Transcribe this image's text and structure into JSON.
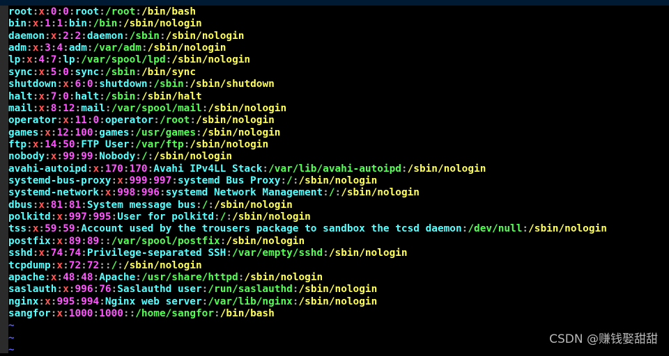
{
  "colors": {
    "name": "#55ffff",
    "password": "#ff5555",
    "ids": "#ff55ff",
    "gecos": "#55ffff",
    "home": "#55ff55",
    "shell": "#ffff55",
    "colon": "#a8a8a8",
    "tilde": "#5c5cff",
    "background": "#000000"
  },
  "lines": [
    "root:x:0:0:root:/root:/bin/bash",
    "bin:x:1:1:bin:/bin:/sbin/nologin",
    "daemon:x:2:2:daemon:/sbin:/sbin/nologin",
    "adm:x:3:4:adm:/var/adm:/sbin/nologin",
    "lp:x:4:7:lp:/var/spool/lpd:/sbin/nologin",
    "sync:x:5:0:sync:/sbin:/bin/sync",
    "shutdown:x:6:0:shutdown:/sbin:/sbin/shutdown",
    "halt:x:7:0:halt:/sbin:/sbin/halt",
    "mail:x:8:12:mail:/var/spool/mail:/sbin/nologin",
    "operator:x:11:0:operator:/root:/sbin/nologin",
    "games:x:12:100:games:/usr/games:/sbin/nologin",
    "ftp:x:14:50:FTP User:/var/ftp:/sbin/nologin",
    "nobody:x:99:99:Nobody:/:/sbin/nologin",
    "avahi-autoipd:x:170:170:Avahi IPv4LL Stack:/var/lib/avahi-autoipd:/sbin/nologin",
    "systemd-bus-proxy:x:999:997:systemd Bus Proxy:/:/sbin/nologin",
    "systemd-network:x:998:996:systemd Network Management:/:/sbin/nologin",
    "dbus:x:81:81:System message bus:/:/sbin/nologin",
    "polkitd:x:997:995:User for polkitd:/:/sbin/nologin",
    "tss:x:59:59:Account used by the trousers package to sandbox the tcsd daemon:/dev/null:/sbin/nologin",
    "postfix:x:89:89::/var/spool/postfix:/sbin/nologin",
    "sshd:x:74:74:Privilege-separated SSH:/var/empty/sshd:/sbin/nologin",
    "tcpdump:x:72:72::/:/sbin/nologin",
    "apache:x:48:48:Apache:/usr/share/httpd:/sbin/nologin",
    "saslauth:x:996:76:Saslauthd user:/run/saslauthd:/sbin/nologin",
    "nginx:x:995:994:Nginx web server:/var/lib/nginx:/sbin/nologin",
    "sangfor:x:1000:1000::/home/sangfor:/bin/bash"
  ],
  "empty_line_marker": "~",
  "empty_line_count": 3,
  "watermark": "CSDN @赚钱娶甜甜"
}
